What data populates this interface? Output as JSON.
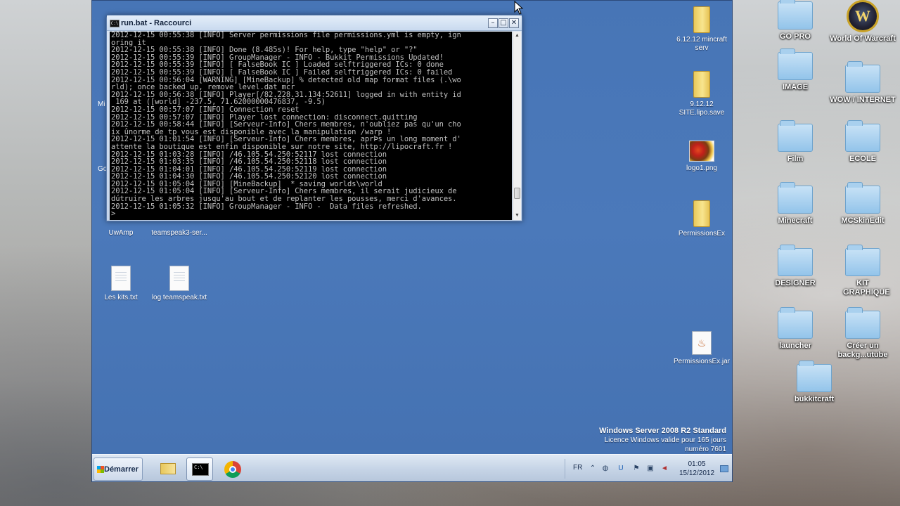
{
  "host_desktop": {
    "icons": [
      {
        "label": "GO PRO",
        "kind": "folder"
      },
      {
        "label": "World Of Warcraft",
        "kind": "wow"
      },
      {
        "label": "IMAGE",
        "kind": "folder"
      },
      {
        "label": "WOW / INTERNET",
        "kind": "folder"
      },
      {
        "label": "Film",
        "kind": "folder"
      },
      {
        "label": "ECOLE",
        "kind": "folder"
      },
      {
        "label": "Minecraft",
        "kind": "folder"
      },
      {
        "label": "MCSkinEdit",
        "kind": "folder"
      },
      {
        "label": "DESIGNER",
        "kind": "folder"
      },
      {
        "label": "KIT GRAPHIQUE",
        "kind": "folder"
      },
      {
        "label": "launcher",
        "kind": "folder"
      },
      {
        "label": "Créer un backg...utube",
        "kind": "folder"
      },
      {
        "label": "bukkitcraft",
        "kind": "folder"
      }
    ]
  },
  "vm_desktop": {
    "icons": [
      {
        "label": "6.12.12 mincraft serv",
        "kind": "folder-yellow"
      },
      {
        "label": "9.12.12 SITE.lipo.save",
        "kind": "folder-yellow"
      },
      {
        "label": "logo1.png",
        "kind": "png"
      },
      {
        "label": "PermissionsEx",
        "kind": "folder-yellow"
      },
      {
        "label": "PermissionsEx.jar",
        "kind": "jar"
      },
      {
        "label": "UwAmp",
        "kind": "app"
      },
      {
        "label": "teamspeak3-ser...",
        "kind": "app"
      },
      {
        "label": "Les kits.txt",
        "kind": "text"
      },
      {
        "label": "log teamspeak.txt",
        "kind": "text"
      }
    ],
    "clipped_labels": [
      "Mi",
      "Go"
    ]
  },
  "console": {
    "title": "run.bat - Raccourci",
    "icon_text": "C:\\",
    "buttons": {
      "minimize": "–",
      "maximize": "□",
      "close": "✕"
    },
    "lines": [
      "2012-12-15 00:55:38 [INFO] Server permissions file permissions.yml is empty, ign",
      "oring it",
      "2012-12-15 00:55:38 [INFO] Done (8.485s)! For help, type \"help\" or \"?\"",
      "2012-12-15 00:55:39 [INFO] GroupManager - INFO - Bukkit Permissions Updated!",
      "2012-12-15 00:55:39 [INFO] [ FalseBook IC ] Loaded selftriggered ICs: 0 done",
      "2012-12-15 00:55:39 [INFO] [ FalseBook IC ] Failed selftriggered ICs: 0 failed",
      "2012-12-15 00:56:04 [WARNING] [MineBackup] % detected old map format files (.\\wo",
      "rld); once backed up, remove level.dat_mcr",
      "2012-12-15 00:56:38 [INFO] Player[/82.228.31.134:52611] logged in with entity id",
      " 169 at ([world] -237.5, 71.62000000476837, -9.5)",
      "2012-12-15 00:57:07 [INFO] Connection reset",
      "2012-12-15 00:57:07 [INFO] Player lost connection: disconnect.quitting",
      "2012-12-15 00:58:44 [INFO] [Serveur-Info] Chers membres, n'oubliez pas qu'un cho",
      "ix ûnorme de tp vous est disponible avec la manipulation /warp !",
      "2012-12-15 01:01:54 [INFO] [Serveur-Info] Chers membres, aprÞs un long moment d'",
      "attente la boutique est enfin disponible sur notre site, http://lipocraft.fr !",
      "2012-12-15 01:03:28 [INFO] /46.105.54.250:52117 lost connection",
      "2012-12-15 01:03:35 [INFO] /46.105.54.250:52118 lost connection",
      "2012-12-15 01:04:01 [INFO] /46.105.54.250:52119 lost connection",
      "2012-12-15 01:04:30 [INFO] /46.105.54.250:52120 lost connection",
      "2012-12-15 01:05:04 [INFO] [MineBackup]  * saving worlds\\world",
      "2012-12-15 01:05:04 [INFO] [Serveur-Info] Chers membres, il serait judicieux de",
      "dútruire les arbres jusqu'au bout et de replanter les pousses, merci d'avances.",
      "2012-12-15 01:05:32 [INFO] GroupManager - INFO -  Data files refreshed.",
      ">"
    ]
  },
  "watermark": {
    "line1": "Windows Server 2008 R2 Standard",
    "line2": "Licence Windows valide pour 165 jours",
    "line3": "numéro 7601"
  },
  "taskbar": {
    "start_label": "Démarrer",
    "cmd_glyph": "C:\\",
    "language": "FR",
    "clock_time": "01:05",
    "clock_date": "15/12/2012"
  },
  "colors": {
    "vm_desktop": "#4572b4",
    "console_bg": "#000000",
    "console_text": "#c0c0c0"
  }
}
